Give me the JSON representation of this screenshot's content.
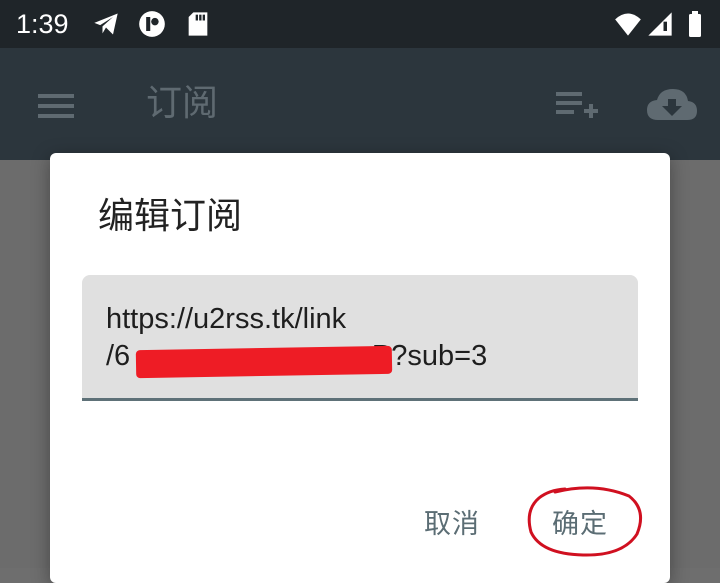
{
  "status_bar": {
    "time": "1:39",
    "icons": [
      "telegram-icon",
      "app-notification-icon",
      "sd-card-icon",
      "wifi-icon",
      "signal-icon",
      "battery-icon"
    ]
  },
  "app_bar": {
    "title": "订阅",
    "icons": [
      "menu-icon",
      "playlist-add-icon",
      "cloud-download-icon"
    ]
  },
  "dialog": {
    "title": "编辑订阅",
    "input_value": "https://u2rss.tk/link\n/6                              P?sub=3",
    "cancel_label": "取消",
    "confirm_label": "确定"
  },
  "colors": {
    "status_bar_bg": "#1f2529",
    "app_bar_bg": "#2c363d",
    "accent": "#5b6d74",
    "redaction": "#ee1c25",
    "annotation": "#d01020"
  }
}
